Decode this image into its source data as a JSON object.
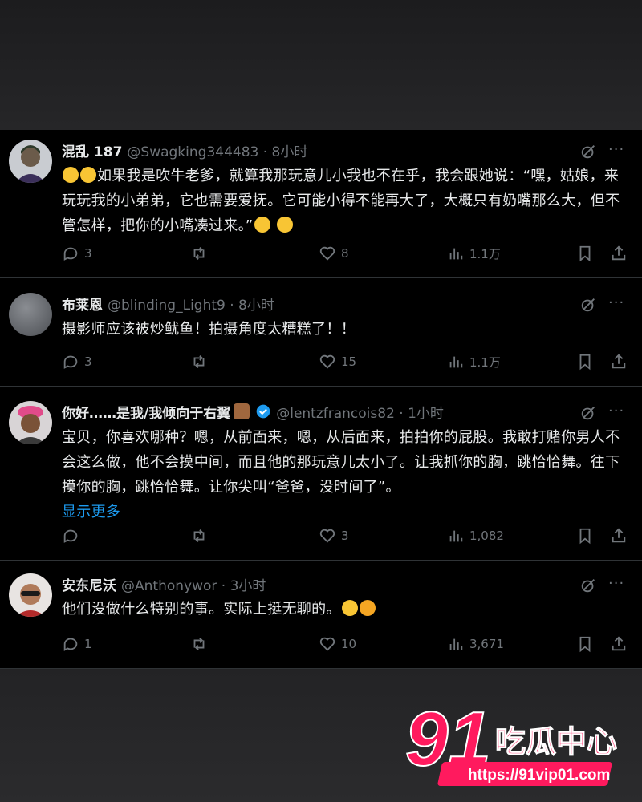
{
  "tweets": [
    {
      "name": "混乱 187",
      "handle": "@Swagking344483 · 8小时",
      "text": "如果我是吹牛老爹，就算我那玩意儿小我也不在乎，我会跟她说：“嘿，姑娘，来玩玩我的小弟弟，它也需要爱抚。它可能小得不能再大了，大概只有奶嘴那么大，但不管怎样，把你的小嘴凑过来。”",
      "replies": "3",
      "retweets": "",
      "likes": "8",
      "views": "1.1万"
    },
    {
      "name": "布莱恩",
      "handle": "@blinding_Light9 · 8小时",
      "text": "摄影师应该被炒鱿鱼！拍摄角度太糟糕了！！",
      "replies": "3",
      "retweets": "",
      "likes": "15",
      "views": "1.1万"
    },
    {
      "name": "你好……是我/我倾向于右翼",
      "handle": "@lentzfrancois82 · 1小时",
      "text": "宝贝，你喜欢哪种？嗯，从前面来，嗯，从后面来，拍拍你的屁股。我敢打赌你男人不会这么做，他不会摸中间，而且他的那玩意儿太小了。让我抓你的胸，跳恰恰舞。往下摸你的胸，跳恰恰舞。让你尖叫“爸爸，没时间了”。",
      "show_more": "显示更多",
      "replies": "",
      "retweets": "",
      "likes": "3",
      "views": "1,082"
    },
    {
      "name": "安东尼沃",
      "handle": "@Anthonywor · 3小时",
      "text": "他们没做什么特别的事。实际上挺无聊的。",
      "replies": "1",
      "retweets": "",
      "likes": "10",
      "views": "3,671"
    }
  ],
  "watermark": {
    "number": "91",
    "brand": "吃瓜中心",
    "url": "https://91vip01.com"
  },
  "colors": {
    "background": "#000000",
    "secondary_text": "#71767b",
    "link": "#1d9bf0",
    "verified": "#1d9bf0",
    "watermark_pink": "#ff1a5e"
  },
  "icons": [
    "grok-icon",
    "more-icon",
    "reply-icon",
    "retweet-icon",
    "like-icon",
    "views-icon",
    "bookmark-icon",
    "share-icon",
    "verified-badge-icon"
  ]
}
